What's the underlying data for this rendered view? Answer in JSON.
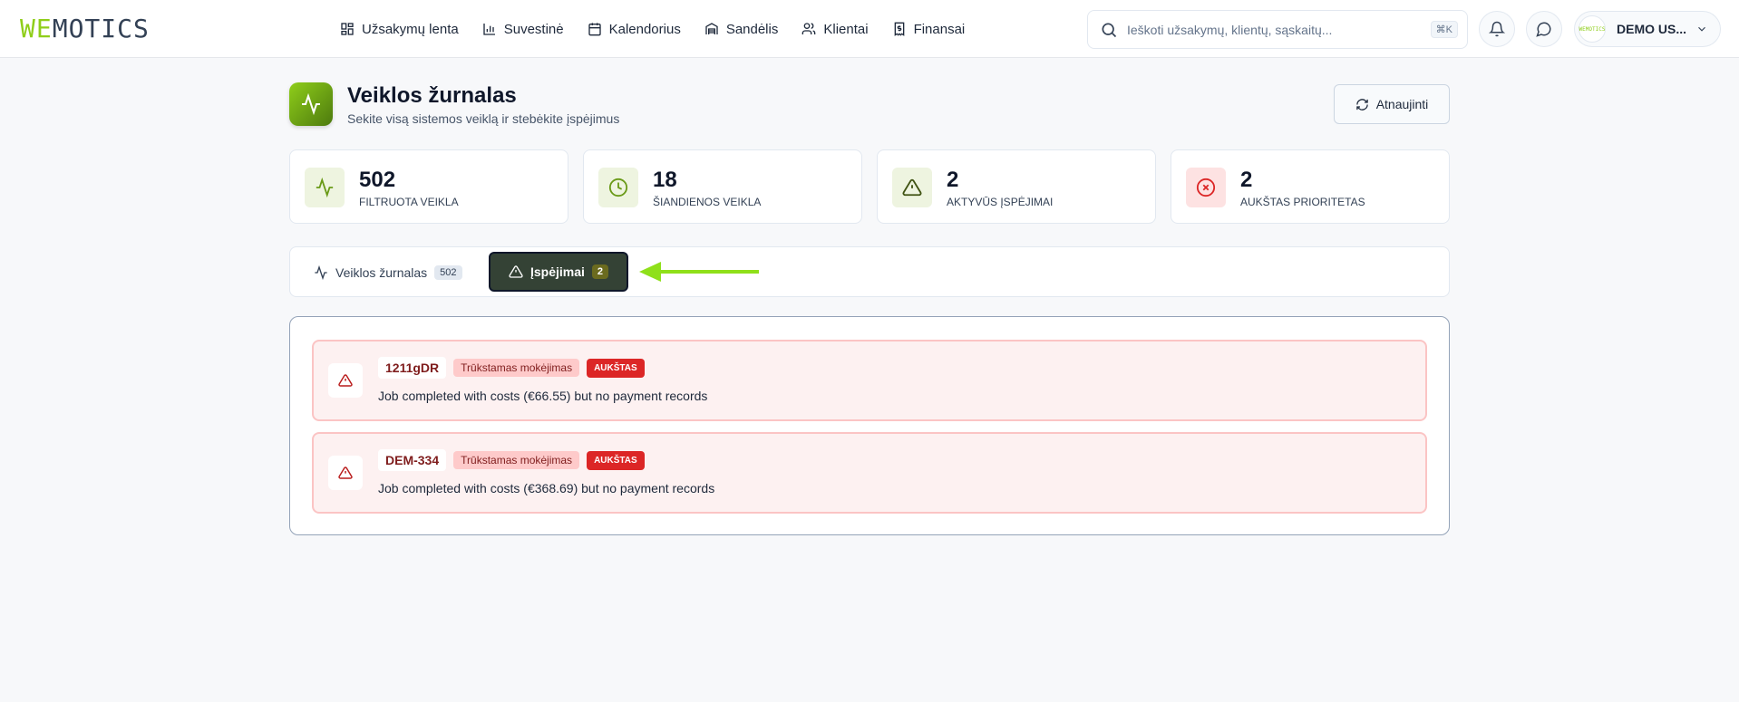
{
  "header": {
    "logo": {
      "part1": "WE",
      "part2": "MOTICS"
    },
    "nav": [
      {
        "label": "Užsakymų lenta",
        "icon": "layout-grid-icon"
      },
      {
        "label": "Suvestinė",
        "icon": "bar-chart-icon"
      },
      {
        "label": "Kalendorius",
        "icon": "calendar-icon"
      },
      {
        "label": "Sandėlis",
        "icon": "warehouse-icon"
      },
      {
        "label": "Klientai",
        "icon": "users-icon"
      },
      {
        "label": "Finansai",
        "icon": "receipt-icon"
      }
    ],
    "search": {
      "placeholder": "Ieškoti užsakymų, klientų, sąskaitų...",
      "shortcut": "⌘K"
    },
    "user": {
      "name": "DEMO US...",
      "avatar_text": "WEMOTICS"
    }
  },
  "page": {
    "title": "Veiklos žurnalas",
    "subtitle": "Sekite visą sistemos veiklą ir stebėkite įspėjimus",
    "refresh_label": "Atnaujinti"
  },
  "stats": [
    {
      "value": "502",
      "label": "FILTRUOTA VEIKLA",
      "icon": "activity-icon",
      "bg": "#eef4e0",
      "color": "#6a9a18"
    },
    {
      "value": "18",
      "label": "ŠIANDIENOS VEIKLA",
      "icon": "clock-icon",
      "bg": "#eef4e0",
      "color": "#6a9a18"
    },
    {
      "value": "2",
      "label": "AKTYVŪS ĮSPĖJIMAI",
      "icon": "warning-icon",
      "bg": "#eef4e0",
      "color": "#3f5212"
    },
    {
      "value": "2",
      "label": "AUKŠTAS PRIORITETAS",
      "icon": "x-circle-icon",
      "bg": "#fde2e2",
      "color": "#dc2626"
    }
  ],
  "tabs": [
    {
      "label": "Veiklos žurnalas",
      "count": "502",
      "active": false
    },
    {
      "label": "Įspėjimai",
      "count": "2",
      "active": true
    }
  ],
  "alerts": [
    {
      "ref": "1211gDR",
      "type": "Trūkstamas mokėjimas",
      "priority": "AUKŠTAS",
      "message": "Job completed with costs (€66.55) but no payment records"
    },
    {
      "ref": "DEM-334",
      "type": "Trūkstamas mokėjimas",
      "priority": "AUKŠTAS",
      "message": "Job completed with costs (€368.69) but no payment records"
    }
  ],
  "colors": {
    "accent": "#8fce1a",
    "active_tab": "#344235",
    "danger": "#dc2626"
  }
}
